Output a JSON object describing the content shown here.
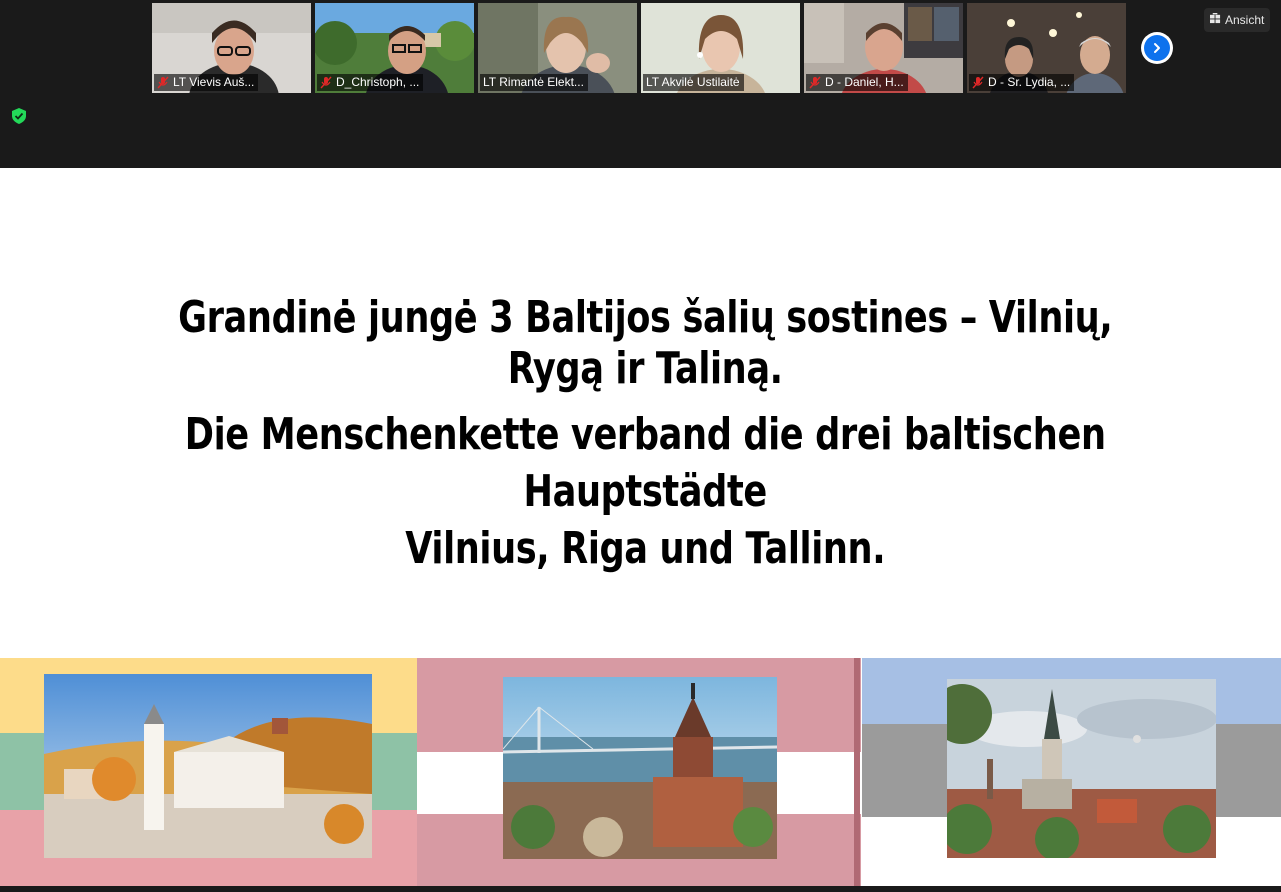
{
  "meeting": {
    "view_button_label": "Ansicht",
    "participants": [
      {
        "name": "LT Vievis Auš...",
        "muted": true
      },
      {
        "name": "D_Christoph, ...",
        "muted": true
      },
      {
        "name": "LT Rimantė Elekt...",
        "muted": false
      },
      {
        "name": "LT Akvilė Ustilaitė",
        "muted": false,
        "active_speaker": true
      },
      {
        "name": "D - Daniel, H...",
        "muted": true
      },
      {
        "name": "D - Sr. Lydia, ...",
        "muted": true
      }
    ]
  },
  "slide": {
    "heading_lt": "Grandinė jungė 3 Baltijos šalių sostines – Vilnių, Rygą ir Taliną.",
    "heading_de_line1": "Die Menschenkette verband die drei baltischen Hauptstädte",
    "heading_de_line2": "Vilnius, Riga und Tallinn.",
    "flags": {
      "lithuania": [
        "#fddc8a",
        "#8ec2a6",
        "#e8a2a8"
      ],
      "latvia": [
        "#d79aa3",
        "#ffffff",
        "#d79aa3"
      ],
      "estonia": [
        "#a6bfe4",
        "#9b9b9b",
        "#ffffff"
      ]
    }
  }
}
